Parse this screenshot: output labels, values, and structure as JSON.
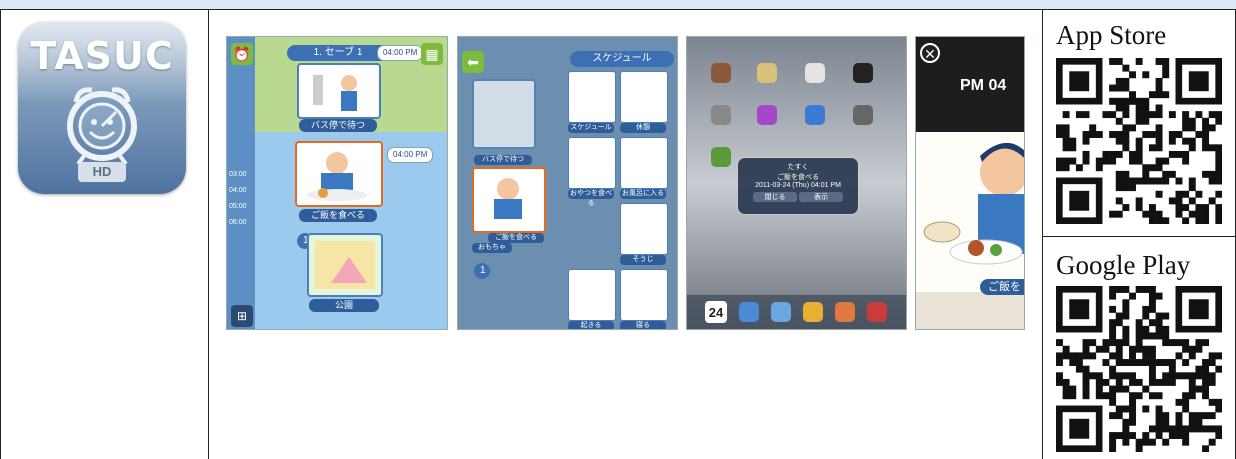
{
  "app_icon": {
    "title": "TASUC",
    "badge": "HD",
    "colors": {
      "top": "#b8c9da",
      "bottom": "#4f73a0"
    }
  },
  "screenshots": {
    "shot1": {
      "header_pill": "1. セーブ 1",
      "header_time": "04:00 PM",
      "captions": [
        "バス停で待つ",
        "ご飯を食べる",
        "公園"
      ],
      "time_bubbles": [
        "04:00 PM"
      ],
      "time_labels": [
        "03:00",
        "04:00",
        "05:00",
        "06:00"
      ],
      "badges": [
        "1",
        "1"
      ]
    },
    "shot2": {
      "header": "スケジュール",
      "left_captions": [
        "バス停で待つ",
        "ご飯を食べる",
        "おもちゃ"
      ],
      "grid_captions": [
        "スケジュール",
        "休憩",
        "おやつを食べる",
        "お風呂に入る",
        "そうじ",
        "起きる",
        "寝る"
      ],
      "badges": [
        "1"
      ]
    },
    "shot3": {
      "dialog_title": "たすく",
      "dialog_line1": "ご飯を食べる",
      "dialog_line2": "2011-03-24 (Thu) 04:01 PM",
      "dialog_buttons": [
        "閉じる",
        "表示"
      ],
      "calendar_day": "24"
    },
    "shot4": {
      "time_text": "PM 04",
      "caption": "ご飯を"
    }
  },
  "stores": {
    "app_store": "App Store",
    "google_play": "Google Play"
  },
  "colors": {
    "accent_blue": "#3d6fb4",
    "accent_green": "#7dbb3e",
    "accent_orange": "#e56b1c",
    "header_band": "#dceaf5"
  }
}
